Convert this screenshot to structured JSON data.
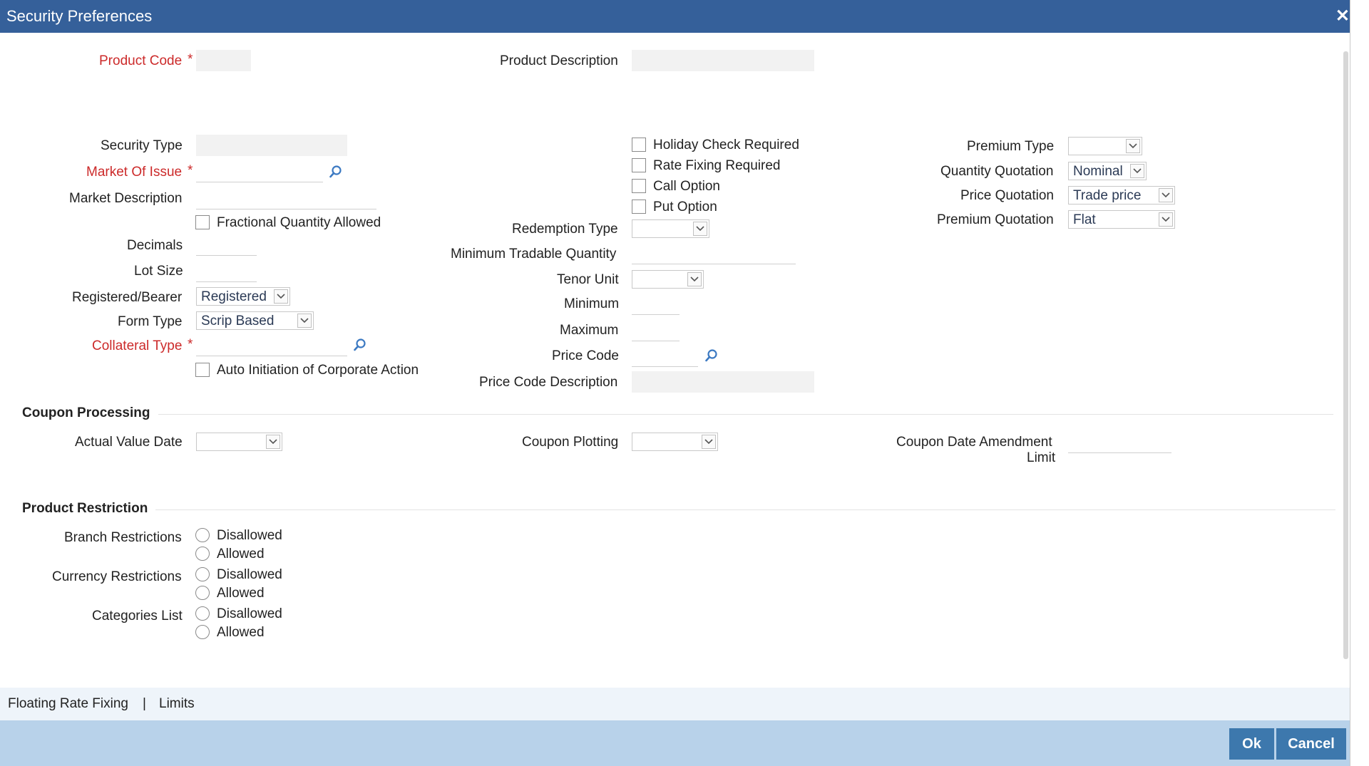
{
  "window": {
    "title": "Security Preferences",
    "close_glyph": "✕"
  },
  "product": {
    "code_label": "Product Code",
    "description_label": "Product Description"
  },
  "left": {
    "security_type_label": "Security Type",
    "market_of_issue_label": "Market Of Issue",
    "market_description_label": "Market Description",
    "fractional_quantity_label": "Fractional Quantity Allowed",
    "decimals_label": "Decimals",
    "lot_size_label": "Lot Size",
    "registered_bearer_label": "Registered/Bearer",
    "registered_bearer_value": "Registered",
    "form_type_label": "Form Type",
    "form_type_value": "Scrip Based",
    "collateral_type_label": "Collateral Type",
    "auto_initiation_label": "Auto Initiation of Corporate Action"
  },
  "middle": {
    "holiday_check_label": "Holiday Check Required",
    "rate_fixing_label": "Rate Fixing Required",
    "call_option_label": "Call Option",
    "put_option_label": "Put Option",
    "redemption_type_label": "Redemption Type",
    "min_tradable_qty_label": "Minimum Tradable Quantity",
    "tenor_unit_label": "Tenor Unit",
    "minimum_label": "Minimum",
    "maximum_label": "Maximum",
    "price_code_label": "Price Code",
    "price_code_desc_label": "Price Code Description"
  },
  "right": {
    "premium_type_label": "Premium Type",
    "quantity_quotation_label": "Quantity Quotation",
    "quantity_quotation_value": "Nominal",
    "price_quotation_label": "Price Quotation",
    "price_quotation_value": "Trade price",
    "premium_quotation_label": "Premium Quotation",
    "premium_quotation_value": "Flat"
  },
  "coupon": {
    "section_title": "Coupon Processing",
    "actual_value_date_label": "Actual Value Date",
    "coupon_plotting_label": "Coupon Plotting",
    "amendment_limit_line1": "Coupon Date Amendment",
    "amendment_limit_line2": "Limit"
  },
  "restriction": {
    "section_title": "Product Restriction",
    "branch_label": "Branch Restrictions",
    "currency_label": "Currency Restrictions",
    "categories_label": "Categories List",
    "disallowed": "Disallowed",
    "allowed": "Allowed"
  },
  "tabs": {
    "floating_rate": "Floating Rate Fixing",
    "separator": "|",
    "limits": "Limits"
  },
  "footer": {
    "ok_label": "Ok",
    "cancel_label": "Cancel"
  },
  "colors": {
    "titlebar": "#35609a",
    "required_label": "#cc2a2a",
    "footer_band": "#b8d2ea",
    "button": "#3d78ad",
    "search_icon": "#3b79c2"
  },
  "icons": [
    "close-icon",
    "search-icon",
    "chevron-down-icon"
  ]
}
